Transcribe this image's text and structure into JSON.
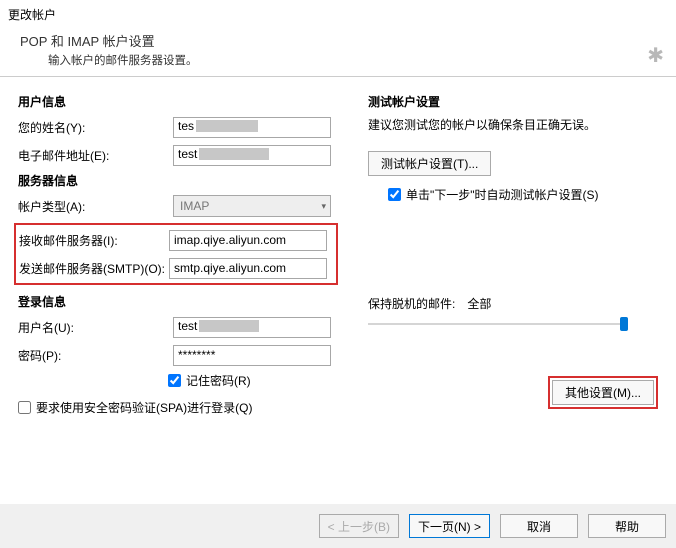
{
  "window": {
    "title": "更改帐户"
  },
  "header": {
    "title": "POP 和 IMAP 帐户设置",
    "subtitle": "输入帐户的邮件服务器设置。"
  },
  "user_info": {
    "section": "用户信息",
    "name_label": "您的姓名(Y):",
    "name_value": "tes",
    "email_label": "电子邮件地址(E):",
    "email_value": "test"
  },
  "server_info": {
    "section": "服务器信息",
    "type_label": "帐户类型(A):",
    "type_value": "IMAP",
    "incoming_label": "接收邮件服务器(I):",
    "incoming_value": "imap.qiye.aliyun.com",
    "outgoing_label": "发送邮件服务器(SMTP)(O):",
    "outgoing_value": "smtp.qiye.aliyun.com"
  },
  "login_info": {
    "section": "登录信息",
    "username_label": "用户名(U):",
    "username_value": "test",
    "password_label": "密码(P):",
    "password_value": "********",
    "remember_label": "记住密码(R)",
    "spa_label": "要求使用安全密码验证(SPA)进行登录(Q)"
  },
  "test": {
    "section": "测试帐户设置",
    "advice": "建议您测试您的帐户以确保条目正确无误。",
    "button": "测试帐户设置(T)...",
    "auto_label": "单击\"下一步\"时自动测试帐户设置(S)"
  },
  "offline": {
    "label": "保持脱机的邮件:",
    "value": "全部"
  },
  "more_settings_label": "其他设置(M)...",
  "footer": {
    "back": "< 上一步(B)",
    "next": "下一页(N) >",
    "cancel": "取消",
    "help": "帮助"
  }
}
